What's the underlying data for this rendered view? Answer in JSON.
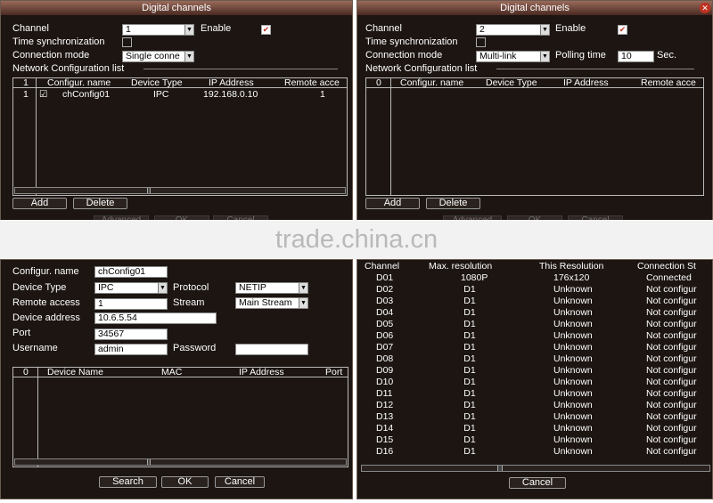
{
  "left_top": {
    "title": "Digital channels",
    "channel_label": "Channel",
    "channel_value": "1",
    "enable_label": "Enable",
    "time_sync_label": "Time synchronization",
    "conn_mode_label": "Connection mode",
    "conn_mode_value": "Single conne",
    "net_list_label": "Network Configuration list",
    "headers": [
      "1",
      "Configur. name",
      "Device Type",
      "IP Address",
      "Remote acce"
    ],
    "row": {
      "idx": "1",
      "check": "☑",
      "name": "chConfig01",
      "type": "IPC",
      "ip": "192.168.0.10",
      "remote": "1"
    },
    "add_label": "Add",
    "delete_label": "Delete",
    "ghost_buttons": [
      "Advanced",
      "OK",
      "Cancel"
    ]
  },
  "right_top": {
    "title": "Digital channels",
    "channel_label": "Channel",
    "channel_value": "2",
    "enable_label": "Enable",
    "time_sync_label": "Time synchronization",
    "conn_mode_label": "Connection mode",
    "conn_mode_value": "Multi-link",
    "polling_label": "Polling time",
    "polling_value": "10",
    "sec_label": "Sec.",
    "net_list_label": "Network Configuration list",
    "headers": [
      "0",
      "Configur. name",
      "Device Type",
      "IP Address",
      "Remote acce"
    ],
    "add_label": "Add",
    "delete_label": "Delete",
    "ghost_buttons": [
      "Advanced",
      "OK",
      "Cancel"
    ]
  },
  "watermark": "trade.china.cn",
  "left_bottom": {
    "config_name_label": "Configur. name",
    "config_name_value": "chConfig01",
    "device_type_label": "Device Type",
    "device_type_value": "IPC",
    "protocol_label": "Protocol",
    "protocol_value": "NETIP",
    "remote_access_label": "Remote access",
    "remote_access_value": "1",
    "stream_label": "Stream",
    "stream_value": "Main Stream",
    "device_address_label": "Device address",
    "device_address_value": "10.6.5.54",
    "port_label": "Port",
    "port_value": "34567",
    "username_label": "Username",
    "username_value": "admin",
    "password_label": "Password",
    "password_value": "",
    "headers": [
      "0",
      "Device Name",
      "MAC",
      "IP Address",
      "Port"
    ],
    "search_label": "Search",
    "ok_label": "OK",
    "cancel_label": "Cancel"
  },
  "right_bottom": {
    "headers": [
      "Channel",
      "Max. resolution",
      "This Resolution",
      "Connection St"
    ],
    "rows": [
      {
        "ch": "D01",
        "max": "1080P",
        "this": "176x120",
        "conn": "Connected"
      },
      {
        "ch": "D02",
        "max": "D1",
        "this": "Unknown",
        "conn": "Not configur"
      },
      {
        "ch": "D03",
        "max": "D1",
        "this": "Unknown",
        "conn": "Not configur"
      },
      {
        "ch": "D04",
        "max": "D1",
        "this": "Unknown",
        "conn": "Not configur"
      },
      {
        "ch": "D05",
        "max": "D1",
        "this": "Unknown",
        "conn": "Not configur"
      },
      {
        "ch": "D06",
        "max": "D1",
        "this": "Unknown",
        "conn": "Not configur"
      },
      {
        "ch": "D07",
        "max": "D1",
        "this": "Unknown",
        "conn": "Not configur"
      },
      {
        "ch": "D08",
        "max": "D1",
        "this": "Unknown",
        "conn": "Not configur"
      },
      {
        "ch": "D09",
        "max": "D1",
        "this": "Unknown",
        "conn": "Not configur"
      },
      {
        "ch": "D10",
        "max": "D1",
        "this": "Unknown",
        "conn": "Not configur"
      },
      {
        "ch": "D11",
        "max": "D1",
        "this": "Unknown",
        "conn": "Not configur"
      },
      {
        "ch": "D12",
        "max": "D1",
        "this": "Unknown",
        "conn": "Not configur"
      },
      {
        "ch": "D13",
        "max": "D1",
        "this": "Unknown",
        "conn": "Not configur"
      },
      {
        "ch": "D14",
        "max": "D1",
        "this": "Unknown",
        "conn": "Not configur"
      },
      {
        "ch": "D15",
        "max": "D1",
        "this": "Unknown",
        "conn": "Not configur"
      },
      {
        "ch": "D16",
        "max": "D1",
        "this": "Unknown",
        "conn": "Not configur"
      }
    ],
    "cancel_label": "Cancel"
  }
}
